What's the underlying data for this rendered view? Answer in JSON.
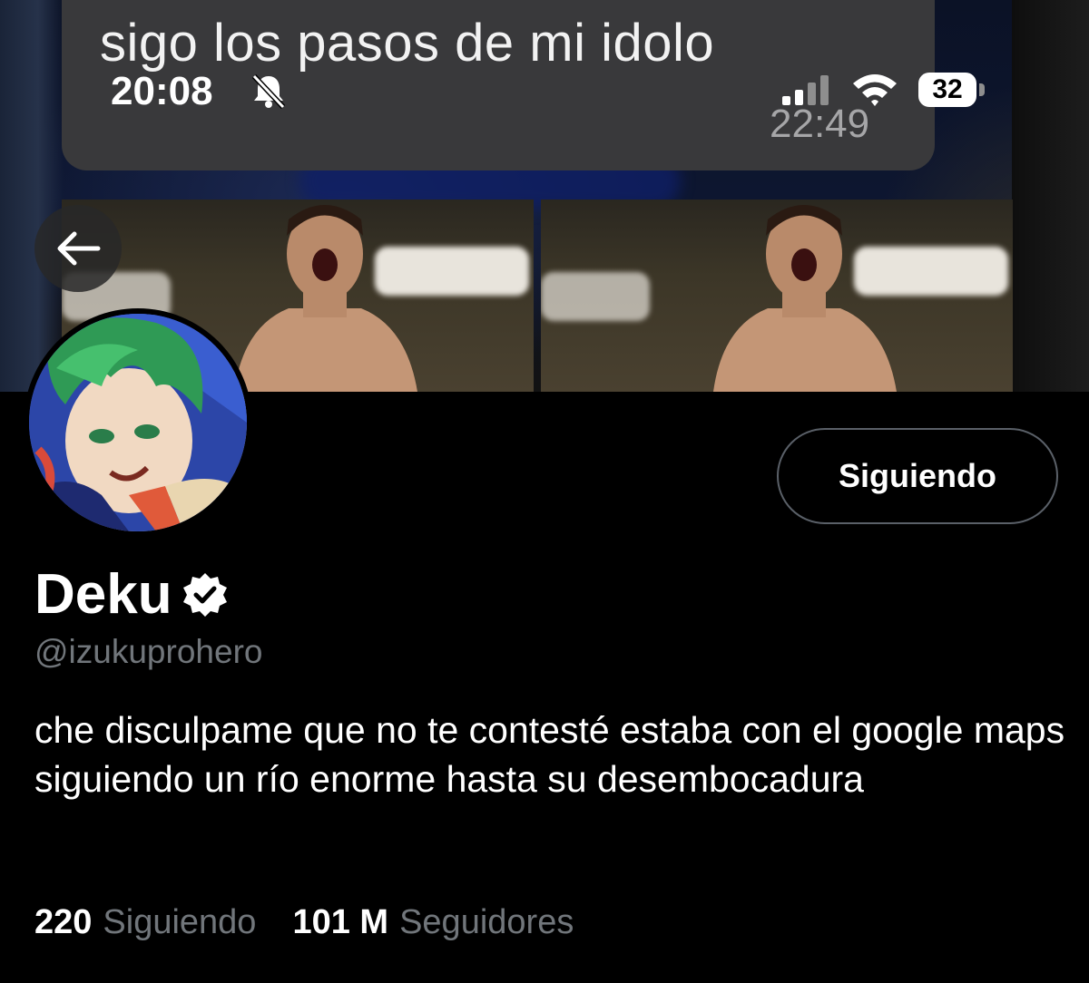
{
  "banner": {
    "message_text": "sigo los pasos de mi idolo",
    "message_time": "22:49"
  },
  "status_bar": {
    "time": "20:08",
    "battery": "32"
  },
  "profile": {
    "follow_button": "Siguiendo",
    "name": "Deku",
    "handle": "@izukuprohero",
    "bio": "che disculpame que no te contesté estaba con el google maps siguiendo un río enorme hasta su desembocadura",
    "following_count": "220",
    "following_label": "Siguiendo",
    "followers_count": "101 M",
    "followers_label": "Seguidores"
  },
  "colors": {
    "background": "#000000",
    "secondary_text": "#71767b",
    "bubble": "#39393b"
  }
}
